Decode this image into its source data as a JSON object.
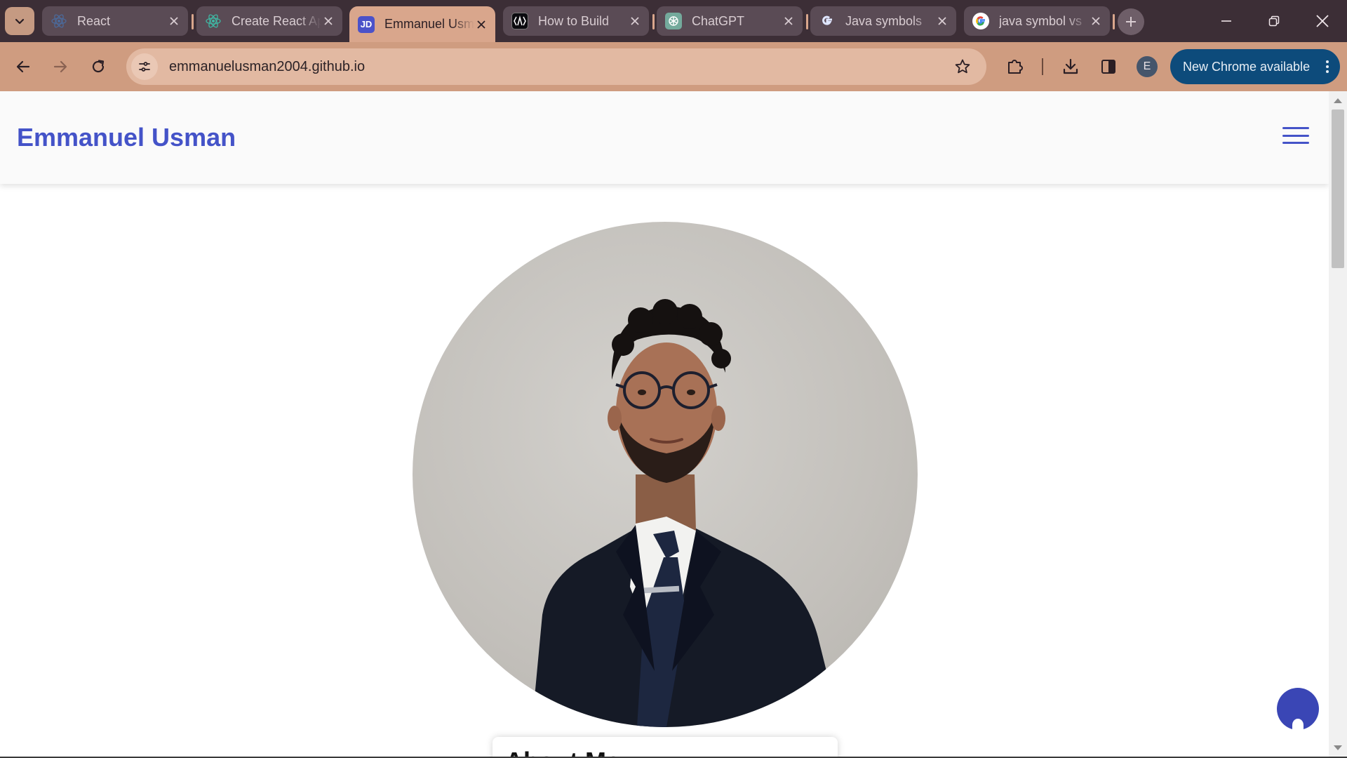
{
  "browser": {
    "tabs": [
      {
        "title": "React",
        "favicon": "react-icon",
        "active": false
      },
      {
        "title": "Create React App",
        "favicon": "react-icon",
        "active": false
      },
      {
        "title": "Emmanuel Usman",
        "favicon": "jd-icon",
        "favicon_text": "JD",
        "active": true
      },
      {
        "title": "How to Build",
        "favicon": "vercel-icon",
        "active": false
      },
      {
        "title": "ChatGPT",
        "favicon": "openai-icon",
        "active": false
      },
      {
        "title": "Java symbols",
        "favicon": "google-icon",
        "active": false
      },
      {
        "title": "java symbol vs",
        "favicon": "google-icon",
        "active": false
      }
    ],
    "url": "emmanuelusman2004.github.io",
    "profile_initial": "E",
    "update_label": "New Chrome available",
    "colors": {
      "frame": "#3c2e36",
      "toolbar": "#cf9c80",
      "active_tab": "#d9a68c",
      "update_pill": "#0d4b7b"
    }
  },
  "page": {
    "brand": "Emmanuel Usman",
    "about_heading": "About Me",
    "colors": {
      "brand": "#4453c8",
      "fab": "#3a46b5"
    }
  }
}
